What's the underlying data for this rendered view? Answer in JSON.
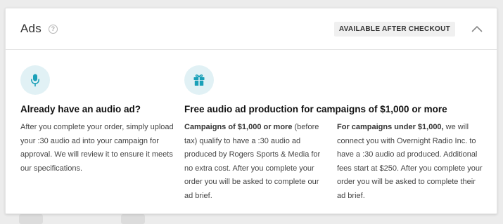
{
  "header": {
    "title": "Ads",
    "help_icon_glyph": "?",
    "badge": "AVAILABLE AFTER CHECKOUT",
    "toggle_icon": "chevron-up-icon"
  },
  "colors": {
    "accent": "#1aa0b8",
    "icon_circle_bg": "#e1f1f5",
    "badge_bg": "#f0f0f0"
  },
  "sections": [
    {
      "icon": "microphone-icon",
      "heading": "Already have an audio ad?",
      "body": "After you complete your order, simply upload your :30 audio ad into your campaign for approval. We will review it to ensure it meets our specifications."
    },
    {
      "icon": "gift-icon",
      "heading": "Free audio ad production for campaigns of $1,000 or more",
      "columns": [
        {
          "bold": "Campaigns of $1,000 or more",
          "text": " (before tax) qualify to have a :30 audio ad produced by Rogers Sports & Media for no extra cost. After you complete your order you will be asked to complete our ad brief."
        },
        {
          "bold": "For campaigns under $1,000,",
          "text": " we will connect you with Overnight Radio Inc. to have a :30 audio ad produced. Additional fees start at $250. After you complete your order you will be asked to complete their ad brief."
        }
      ]
    }
  ]
}
